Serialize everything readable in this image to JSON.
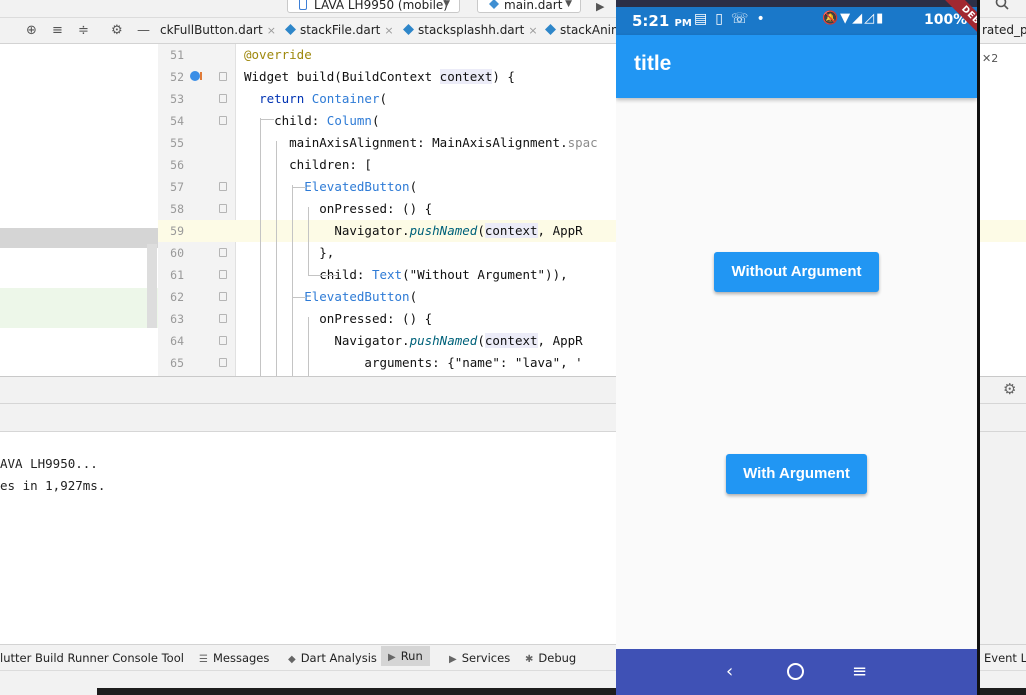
{
  "toolbar": {
    "device_label": "LAVA LH9950 (mobile)",
    "file_label": "main.dart"
  },
  "tabs": [
    {
      "label": "ckFullButton.dart"
    },
    {
      "label": "stackFile.dart"
    },
    {
      "label": "stacksplashh.dart"
    },
    {
      "label": "stackAnim"
    },
    {
      "label": "rated_p"
    }
  ],
  "editor": {
    "right_badge": "2",
    "lines": [
      {
        "num": "51",
        "indent": "",
        "parts": [
          [
            "ann",
            "@override"
          ]
        ]
      },
      {
        "num": "52",
        "indent": "",
        "parts": [
          [
            "plain",
            "Widget build(BuildContext "
          ],
          [
            "param",
            "context"
          ],
          [
            "plain",
            ") {"
          ]
        ]
      },
      {
        "num": "53",
        "indent": "  ",
        "parts": [
          [
            "kw",
            "return "
          ],
          [
            "type",
            "Container"
          ],
          [
            "plain",
            "("
          ]
        ]
      },
      {
        "num": "54",
        "indent": "    ",
        "parts": [
          [
            "plain",
            "child: "
          ],
          [
            "type",
            "Column"
          ],
          [
            "plain",
            "("
          ]
        ]
      },
      {
        "num": "55",
        "indent": "      ",
        "parts": [
          [
            "plain",
            "mainAxisAlignment: MainAxisAlignment."
          ],
          [
            "mute",
            "spac"
          ]
        ]
      },
      {
        "num": "56",
        "indent": "      ",
        "parts": [
          [
            "plain",
            "children: ["
          ]
        ]
      },
      {
        "num": "57",
        "indent": "        ",
        "parts": [
          [
            "type",
            "ElevatedButton"
          ],
          [
            "plain",
            "("
          ]
        ]
      },
      {
        "num": "58",
        "indent": "          ",
        "parts": [
          [
            "plain",
            "onPressed: () {"
          ]
        ]
      },
      {
        "num": "59",
        "indent": "            ",
        "parts": [
          [
            "plain",
            "Navigator."
          ],
          [
            "fn",
            "pushNamed"
          ],
          [
            "plain",
            "("
          ],
          [
            "param",
            "context"
          ],
          [
            "plain",
            ", AppR"
          ]
        ]
      },
      {
        "num": "60",
        "indent": "          ",
        "parts": [
          [
            "plain",
            "},"
          ]
        ]
      },
      {
        "num": "61",
        "indent": "          ",
        "parts": [
          [
            "plain",
            "child: "
          ],
          [
            "type",
            "Text"
          ],
          [
            "plain",
            "(\"Without Argument\")),"
          ]
        ]
      },
      {
        "num": "62",
        "indent": "        ",
        "parts": [
          [
            "type",
            "ElevatedButton"
          ],
          [
            "plain",
            "("
          ]
        ]
      },
      {
        "num": "63",
        "indent": "          ",
        "parts": [
          [
            "plain",
            "onPressed: () {"
          ]
        ]
      },
      {
        "num": "64",
        "indent": "            ",
        "parts": [
          [
            "plain",
            "Navigator."
          ],
          [
            "fn",
            "pushNamed"
          ],
          [
            "plain",
            "("
          ],
          [
            "param",
            "context"
          ],
          [
            "plain",
            ", AppR"
          ]
        ]
      },
      {
        "num": "65",
        "indent": "                ",
        "parts": [
          [
            "plain",
            "arguments: {\"name\": \"lava\", '"
          ]
        ]
      }
    ]
  },
  "console": {
    "lines": [
      "AVA LH9950...",
      "es in 1,927ms."
    ]
  },
  "bottom_tools": {
    "build_runner": "lutter Build Runner Console Tool",
    "messages": "Messages",
    "dart_analysis": "Dart Analysis",
    "run": "Run",
    "services": "Services",
    "debug": "Debug",
    "event_log": "Event L"
  },
  "phone": {
    "status_time": "5:21",
    "status_ampm": "PM",
    "battery": "100%",
    "debug_banner": "DEBUG",
    "appbar_title": "title",
    "button_without": "Without Argument",
    "button_with": "With Argument"
  }
}
